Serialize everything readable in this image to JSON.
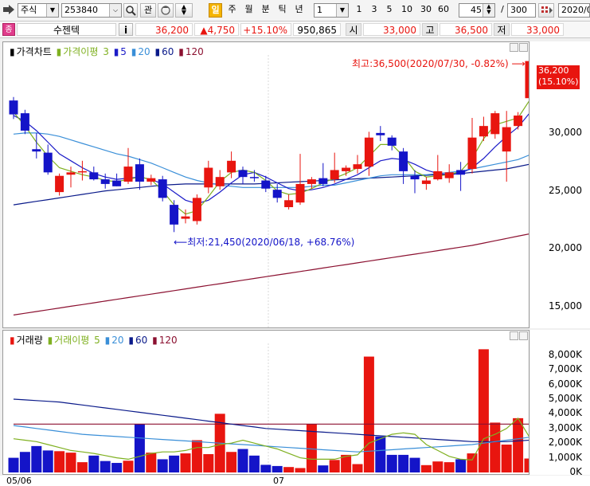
{
  "toolbar": {
    "market_select": "주식",
    "code_input": "253840",
    "btn_watch": "관",
    "period_tab_active": "일",
    "period_tabs": [
      "주",
      "월",
      "분",
      "틱",
      "년"
    ],
    "interval_select": "1",
    "interval_presets": [
      "1",
      "3",
      "5",
      "10",
      "30",
      "60"
    ],
    "visible_count": "45",
    "separator": "/",
    "total_count": "300",
    "date_field": "2020/0"
  },
  "quote": {
    "tag": "종",
    "name": "수젠텍",
    "info_btn": "i",
    "price": "36,200",
    "change": "▲4,750",
    "change_pct": "+15.10%",
    "volume": "950,865",
    "open_label": "시",
    "open": "33,000",
    "high_label": "고",
    "high": "36,500",
    "low_label": "저",
    "low": "33,000"
  },
  "price_panel": {
    "legend_title": "가격차트",
    "legend_ma_title": "가격이평",
    "legend_periods": [
      "3",
      "5",
      "20",
      "60",
      "120"
    ],
    "y_ticks": [
      "30,000",
      "25,000",
      "20,000",
      "15,000"
    ],
    "current_price_label": "36,200",
    "current_pct_label": "(15.10%)",
    "max_annotation": "최고:36,500(2020/07/30, -0.82%)",
    "min_annotation": "최저:21,450(2020/06/18, +68.76%)",
    "colors": {
      "up": "#e8150f",
      "down": "#1414c8",
      "ma3": "#7fb020",
      "ma5": "#1c1cc8",
      "ma20": "#3a8fd8",
      "ma60": "#0a1a8a",
      "ma120": "#8b1030"
    }
  },
  "volume_panel": {
    "legend_title": "거래량",
    "legend_ma_title": "거래이평",
    "legend_periods": [
      "5",
      "20",
      "60",
      "120"
    ],
    "y_ticks": [
      "8,000K",
      "7,000K",
      "6,000K",
      "5,000K",
      "4,000K",
      "3,000K",
      "2,000K",
      "1,000K",
      "0K"
    ]
  },
  "x_axis": {
    "labels": [
      "05/06",
      "07"
    ]
  },
  "chart_data": {
    "type": "candlestick",
    "title": "가격차트",
    "symbol": "253840",
    "name": "수젠텍",
    "ylim": [
      13500,
      37000
    ],
    "candles": [
      {
        "o": 32800,
        "h": 33100,
        "l": 31200,
        "c": 31600
      },
      {
        "o": 31700,
        "h": 32000,
        "l": 29900,
        "c": 30200
      },
      {
        "o": 28600,
        "h": 30000,
        "l": 27800,
        "c": 28400
      },
      {
        "o": 28300,
        "h": 29000,
        "l": 26400,
        "c": 26600
      },
      {
        "o": 24900,
        "h": 26500,
        "l": 24600,
        "c": 26300
      },
      {
        "o": 26400,
        "h": 27100,
        "l": 25300,
        "c": 26600
      },
      {
        "o": 26600,
        "h": 27600,
        "l": 25900,
        "c": 26700
      },
      {
        "o": 26600,
        "h": 27100,
        "l": 25900,
        "c": 26000
      },
      {
        "o": 26000,
        "h": 26500,
        "l": 25200,
        "c": 25600
      },
      {
        "o": 25900,
        "h": 26500,
        "l": 25400,
        "c": 25400
      },
      {
        "o": 25800,
        "h": 28700,
        "l": 25600,
        "c": 27100
      },
      {
        "o": 27300,
        "h": 27800,
        "l": 25100,
        "c": 25800
      },
      {
        "o": 25800,
        "h": 26400,
        "l": 25500,
        "c": 26100
      },
      {
        "o": 26000,
        "h": 26300,
        "l": 24100,
        "c": 24400
      },
      {
        "o": 23800,
        "h": 24200,
        "l": 21450,
        "c": 22100
      },
      {
        "o": 22600,
        "h": 23400,
        "l": 22200,
        "c": 22800
      },
      {
        "o": 22400,
        "h": 24700,
        "l": 22100,
        "c": 24400
      },
      {
        "o": 25300,
        "h": 27600,
        "l": 24800,
        "c": 27000
      },
      {
        "o": 25400,
        "h": 26800,
        "l": 25100,
        "c": 26200
      },
      {
        "o": 26600,
        "h": 28400,
        "l": 26100,
        "c": 27600
      },
      {
        "o": 26800,
        "h": 27100,
        "l": 25600,
        "c": 26200
      },
      {
        "o": 26200,
        "h": 26800,
        "l": 25800,
        "c": 26100
      },
      {
        "o": 25900,
        "h": 26300,
        "l": 24900,
        "c": 25200
      },
      {
        "o": 25100,
        "h": 25600,
        "l": 24000,
        "c": 24400
      },
      {
        "o": 23600,
        "h": 24700,
        "l": 23400,
        "c": 24200
      },
      {
        "o": 24000,
        "h": 28200,
        "l": 23800,
        "c": 25600
      },
      {
        "o": 25600,
        "h": 26200,
        "l": 25200,
        "c": 26000
      },
      {
        "o": 26100,
        "h": 27400,
        "l": 25400,
        "c": 25600
      },
      {
        "o": 26000,
        "h": 28300,
        "l": 25700,
        "c": 26800
      },
      {
        "o": 26700,
        "h": 27200,
        "l": 26300,
        "c": 27000
      },
      {
        "o": 26900,
        "h": 28100,
        "l": 26500,
        "c": 27300
      },
      {
        "o": 27100,
        "h": 30100,
        "l": 26300,
        "c": 29600
      },
      {
        "o": 30000,
        "h": 30600,
        "l": 29300,
        "c": 29800
      },
      {
        "o": 29600,
        "h": 29800,
        "l": 28500,
        "c": 28900
      },
      {
        "o": 28400,
        "h": 28700,
        "l": 25600,
        "c": 26700
      },
      {
        "o": 26300,
        "h": 26800,
        "l": 24800,
        "c": 26000
      },
      {
        "o": 25600,
        "h": 26200,
        "l": 25100,
        "c": 25900
      },
      {
        "o": 26000,
        "h": 28100,
        "l": 25900,
        "c": 26700
      },
      {
        "o": 26100,
        "h": 27300,
        "l": 25700,
        "c": 26600
      },
      {
        "o": 26800,
        "h": 27500,
        "l": 25000,
        "c": 26400
      },
      {
        "o": 26900,
        "h": 31300,
        "l": 26500,
        "c": 29600
      },
      {
        "o": 29700,
        "h": 31400,
        "l": 29300,
        "c": 30600
      },
      {
        "o": 29900,
        "h": 31900,
        "l": 29500,
        "c": 31700
      },
      {
        "o": 28400,
        "h": 31900,
        "l": 25800,
        "c": 30500
      },
      {
        "o": 30600,
        "h": 31800,
        "l": 30300,
        "c": 31500
      },
      {
        "o": 33000,
        "h": 36500,
        "l": 33000,
        "c": 36200
      }
    ],
    "ma": {
      "ma3": [
        31800,
        30600,
        29200,
        28000,
        27000,
        26700,
        26400,
        26200,
        25900,
        25800,
        26000,
        26200,
        26000,
        25000,
        23800,
        23000,
        23300,
        24500,
        25800,
        26600,
        26800,
        26600,
        25900,
        25000,
        24700,
        24800,
        25200,
        25700,
        26100,
        26500,
        27000,
        28000,
        29000,
        29000,
        28000,
        26700,
        26200,
        26300,
        26400,
        26700,
        27800,
        29500,
        30700,
        31000,
        31300,
        32800
      ],
      "ma5": [
        31500,
        31000,
        30200,
        29200,
        28200,
        27600,
        27000,
        26500,
        26200,
        26000,
        26100,
        26200,
        26000,
        25600,
        24900,
        24200,
        23900,
        24200,
        24900,
        25700,
        26400,
        26600,
        26200,
        25700,
        25200,
        25000,
        25100,
        25300,
        25600,
        26000,
        26400,
        27000,
        27600,
        27800,
        27700,
        27300,
        26800,
        26500,
        26400,
        26500,
        27000,
        27800,
        28800,
        29700,
        30500,
        31700
      ],
      "ma20": [
        29900,
        30000,
        30000,
        29900,
        29700,
        29400,
        29100,
        28800,
        28500,
        28200,
        28000,
        27700,
        27400,
        27000,
        26600,
        26200,
        25900,
        25700,
        25500,
        25400,
        25300,
        25300,
        25300,
        25300,
        25300,
        25300,
        25400,
        25500,
        25500,
        25700,
        25900,
        26100,
        26300,
        26400,
        26400,
        26400,
        26400,
        26500,
        26600,
        26700,
        26900,
        27100,
        27300,
        27500,
        27700,
        28100
      ],
      "ma60": [
        23800,
        23950,
        24100,
        24250,
        24400,
        24550,
        24700,
        24850,
        25000,
        25100,
        25200,
        25300,
        25400,
        25500,
        25550,
        25600,
        25600,
        25600,
        25600,
        25600,
        25600,
        25600,
        25650,
        25700,
        25750,
        25800,
        25850,
        25900,
        25950,
        26000,
        26050,
        26100,
        26150,
        26200,
        26250,
        26300,
        26350,
        26400,
        26450,
        26500,
        26600,
        26700,
        26800,
        26900,
        27100,
        27300
      ],
      "ma120": [
        14300,
        14450,
        14600,
        14750,
        14900,
        15050,
        15200,
        15350,
        15500,
        15650,
        15800,
        15950,
        16100,
        16250,
        16400,
        16550,
        16700,
        16850,
        17000,
        17150,
        17300,
        17450,
        17600,
        17750,
        17900,
        18050,
        18200,
        18350,
        18500,
        18650,
        18800,
        18950,
        19100,
        19250,
        19400,
        19550,
        19700,
        19850,
        20000,
        20150,
        20300,
        20500,
        20700,
        20900,
        21100,
        21300
      ]
    },
    "volume_k": [
      1000,
      1400,
      1800,
      1500,
      1450,
      1350,
      700,
      1150,
      780,
      650,
      800,
      3300,
      1350,
      900,
      1150,
      1300,
      2200,
      1250,
      4000,
      1400,
      1600,
      1150,
      520,
      440,
      370,
      300,
      3300,
      480,
      850,
      1200,
      570,
      7900,
      2450,
      1200,
      1200,
      1000,
      500,
      750,
      700,
      900,
      1300,
      8400,
      3400,
      1900,
      3700,
      950
    ],
    "volume_ylim": [
      0,
      8800
    ],
    "volume_ma": {
      "ma5": [
        2300,
        2200,
        2100,
        1900,
        1700,
        1500,
        1400,
        1300,
        1150,
        1000,
        900,
        1100,
        1300,
        1400,
        1400,
        1500,
        1700,
        1700,
        1900,
        2000,
        2200,
        2000,
        1800,
        1600,
        1300,
        1000,
        900,
        900,
        900,
        1100,
        1200,
        2000,
        2300,
        2600,
        2700,
        2600,
        1900,
        1500,
        1100,
        900,
        850,
        2300,
        2600,
        3000,
        3700,
        2400
      ],
      "ma20": [
        3200,
        3100,
        3000,
        2900,
        2800,
        2700,
        2600,
        2550,
        2500,
        2450,
        2400,
        2350,
        2300,
        2250,
        2200,
        2150,
        2100,
        2050,
        2000,
        1950,
        1900,
        1850,
        1800,
        1750,
        1700,
        1650,
        1600,
        1550,
        1500,
        1450,
        1400,
        1450,
        1500,
        1550,
        1600,
        1650,
        1700,
        1750,
        1800,
        1850,
        1900,
        2000,
        2100,
        2200,
        2300,
        2400
      ],
      "ma60": [
        5000,
        4950,
        4900,
        4850,
        4800,
        4700,
        4600,
        4500,
        4400,
        4300,
        4200,
        4100,
        4000,
        3900,
        3800,
        3700,
        3600,
        3500,
        3400,
        3300,
        3200,
        3100,
        3000,
        2950,
        2900,
        2850,
        2800,
        2750,
        2700,
        2650,
        2600,
        2550,
        2500,
        2450,
        2400,
        2350,
        2300,
        2250,
        2200,
        2150,
        2100,
        2100,
        2100,
        2100,
        2150,
        2200
      ],
      "ma120": [
        3300,
        3300,
        3300,
        3300,
        3300,
        3300,
        3300,
        3300,
        3300,
        3300,
        3300,
        3300,
        3300,
        3300,
        3300,
        3300,
        3300,
        3300,
        3300,
        3300,
        3300,
        3300,
        3300,
        3300,
        3300,
        3300,
        3300,
        3300,
        3300,
        3300,
        3300,
        3300,
        3300,
        3300,
        3300,
        3300,
        3300,
        3300,
        3300,
        3300,
        3300,
        3300,
        3300,
        3300,
        3300,
        3300
      ]
    }
  }
}
